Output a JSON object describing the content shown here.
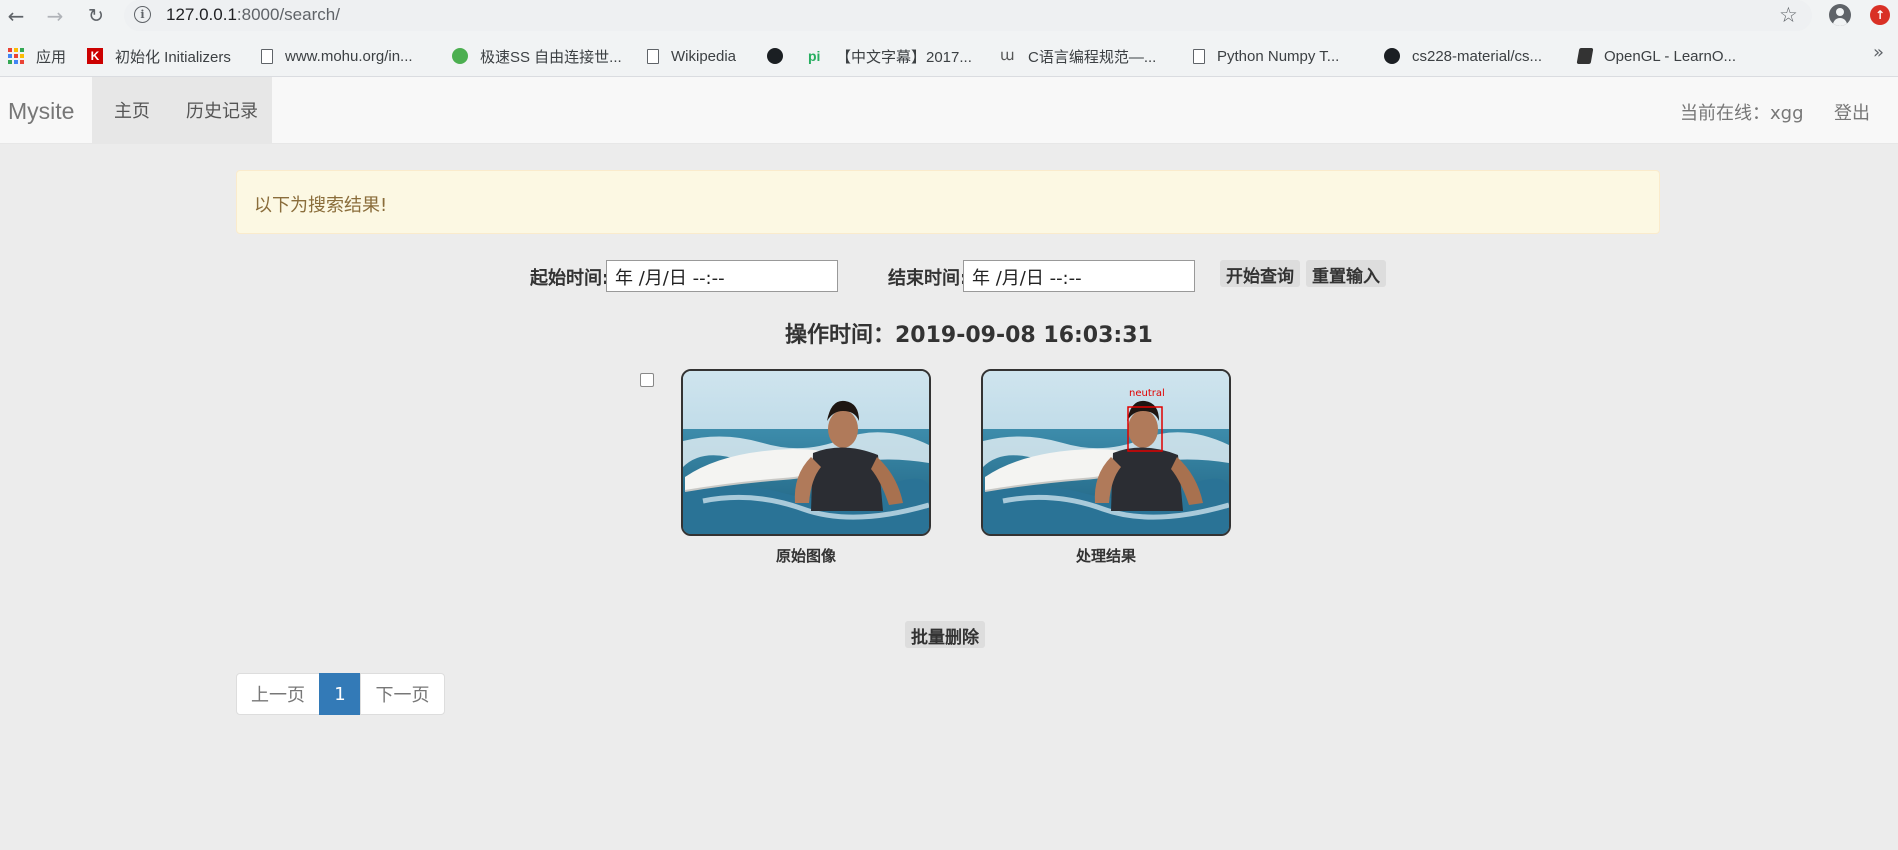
{
  "browser": {
    "url_host": "127.0.0.1",
    "url_rest": ":8000/search/",
    "bookmarks": [
      {
        "label": "应用",
        "icon": "apps-icon"
      },
      {
        "label": "初始化 Initializers",
        "icon": "k-logo-icon"
      },
      {
        "label": "www.mohu.org/in...",
        "icon": "page-icon"
      },
      {
        "label": "极速SS 自由连接世...",
        "icon": "green-circle-icon"
      },
      {
        "label": "Wikipedia",
        "icon": "page-icon"
      },
      {
        "label": "",
        "icon": "github-icon"
      },
      {
        "label": "【中文字幕】2017...",
        "icon": "pi-icon"
      },
      {
        "label": "C语言编程规范—...",
        "icon": "glyph-icon"
      },
      {
        "label": "Python Numpy T...",
        "icon": "page-icon"
      },
      {
        "label": "cs228-material/cs...",
        "icon": "github-icon"
      },
      {
        "label": "OpenGL - LearnO...",
        "icon": "book-icon"
      }
    ],
    "more": "»"
  },
  "navbar": {
    "brand": "Mysite",
    "home": "主页",
    "history": "历史记录",
    "user": "当前在线：xgg",
    "logout": "登出"
  },
  "alert": {
    "message": "以下为搜索结果!"
  },
  "search": {
    "start_label": "起始时间:",
    "start_value": "年 /月/日 --:--",
    "end_label": "结束时间:",
    "end_value": "年 /月/日 --:--",
    "query_button": "开始查询",
    "reset_button": "重置输入"
  },
  "record": {
    "operation_time": "操作时间：2019-09-08 16:03:31",
    "original_caption": "原始图像",
    "processed_caption": "处理结果",
    "detected_label": "neutral"
  },
  "actions": {
    "batch_delete": "批量删除"
  },
  "pagination": {
    "prev": "上一页",
    "current": "1",
    "next": "下一页"
  },
  "colors": {
    "primary": "#337ab7",
    "alert_bg": "#fcf8e3",
    "alert_text": "#8a6d3b",
    "detect_box": "#e00000"
  }
}
